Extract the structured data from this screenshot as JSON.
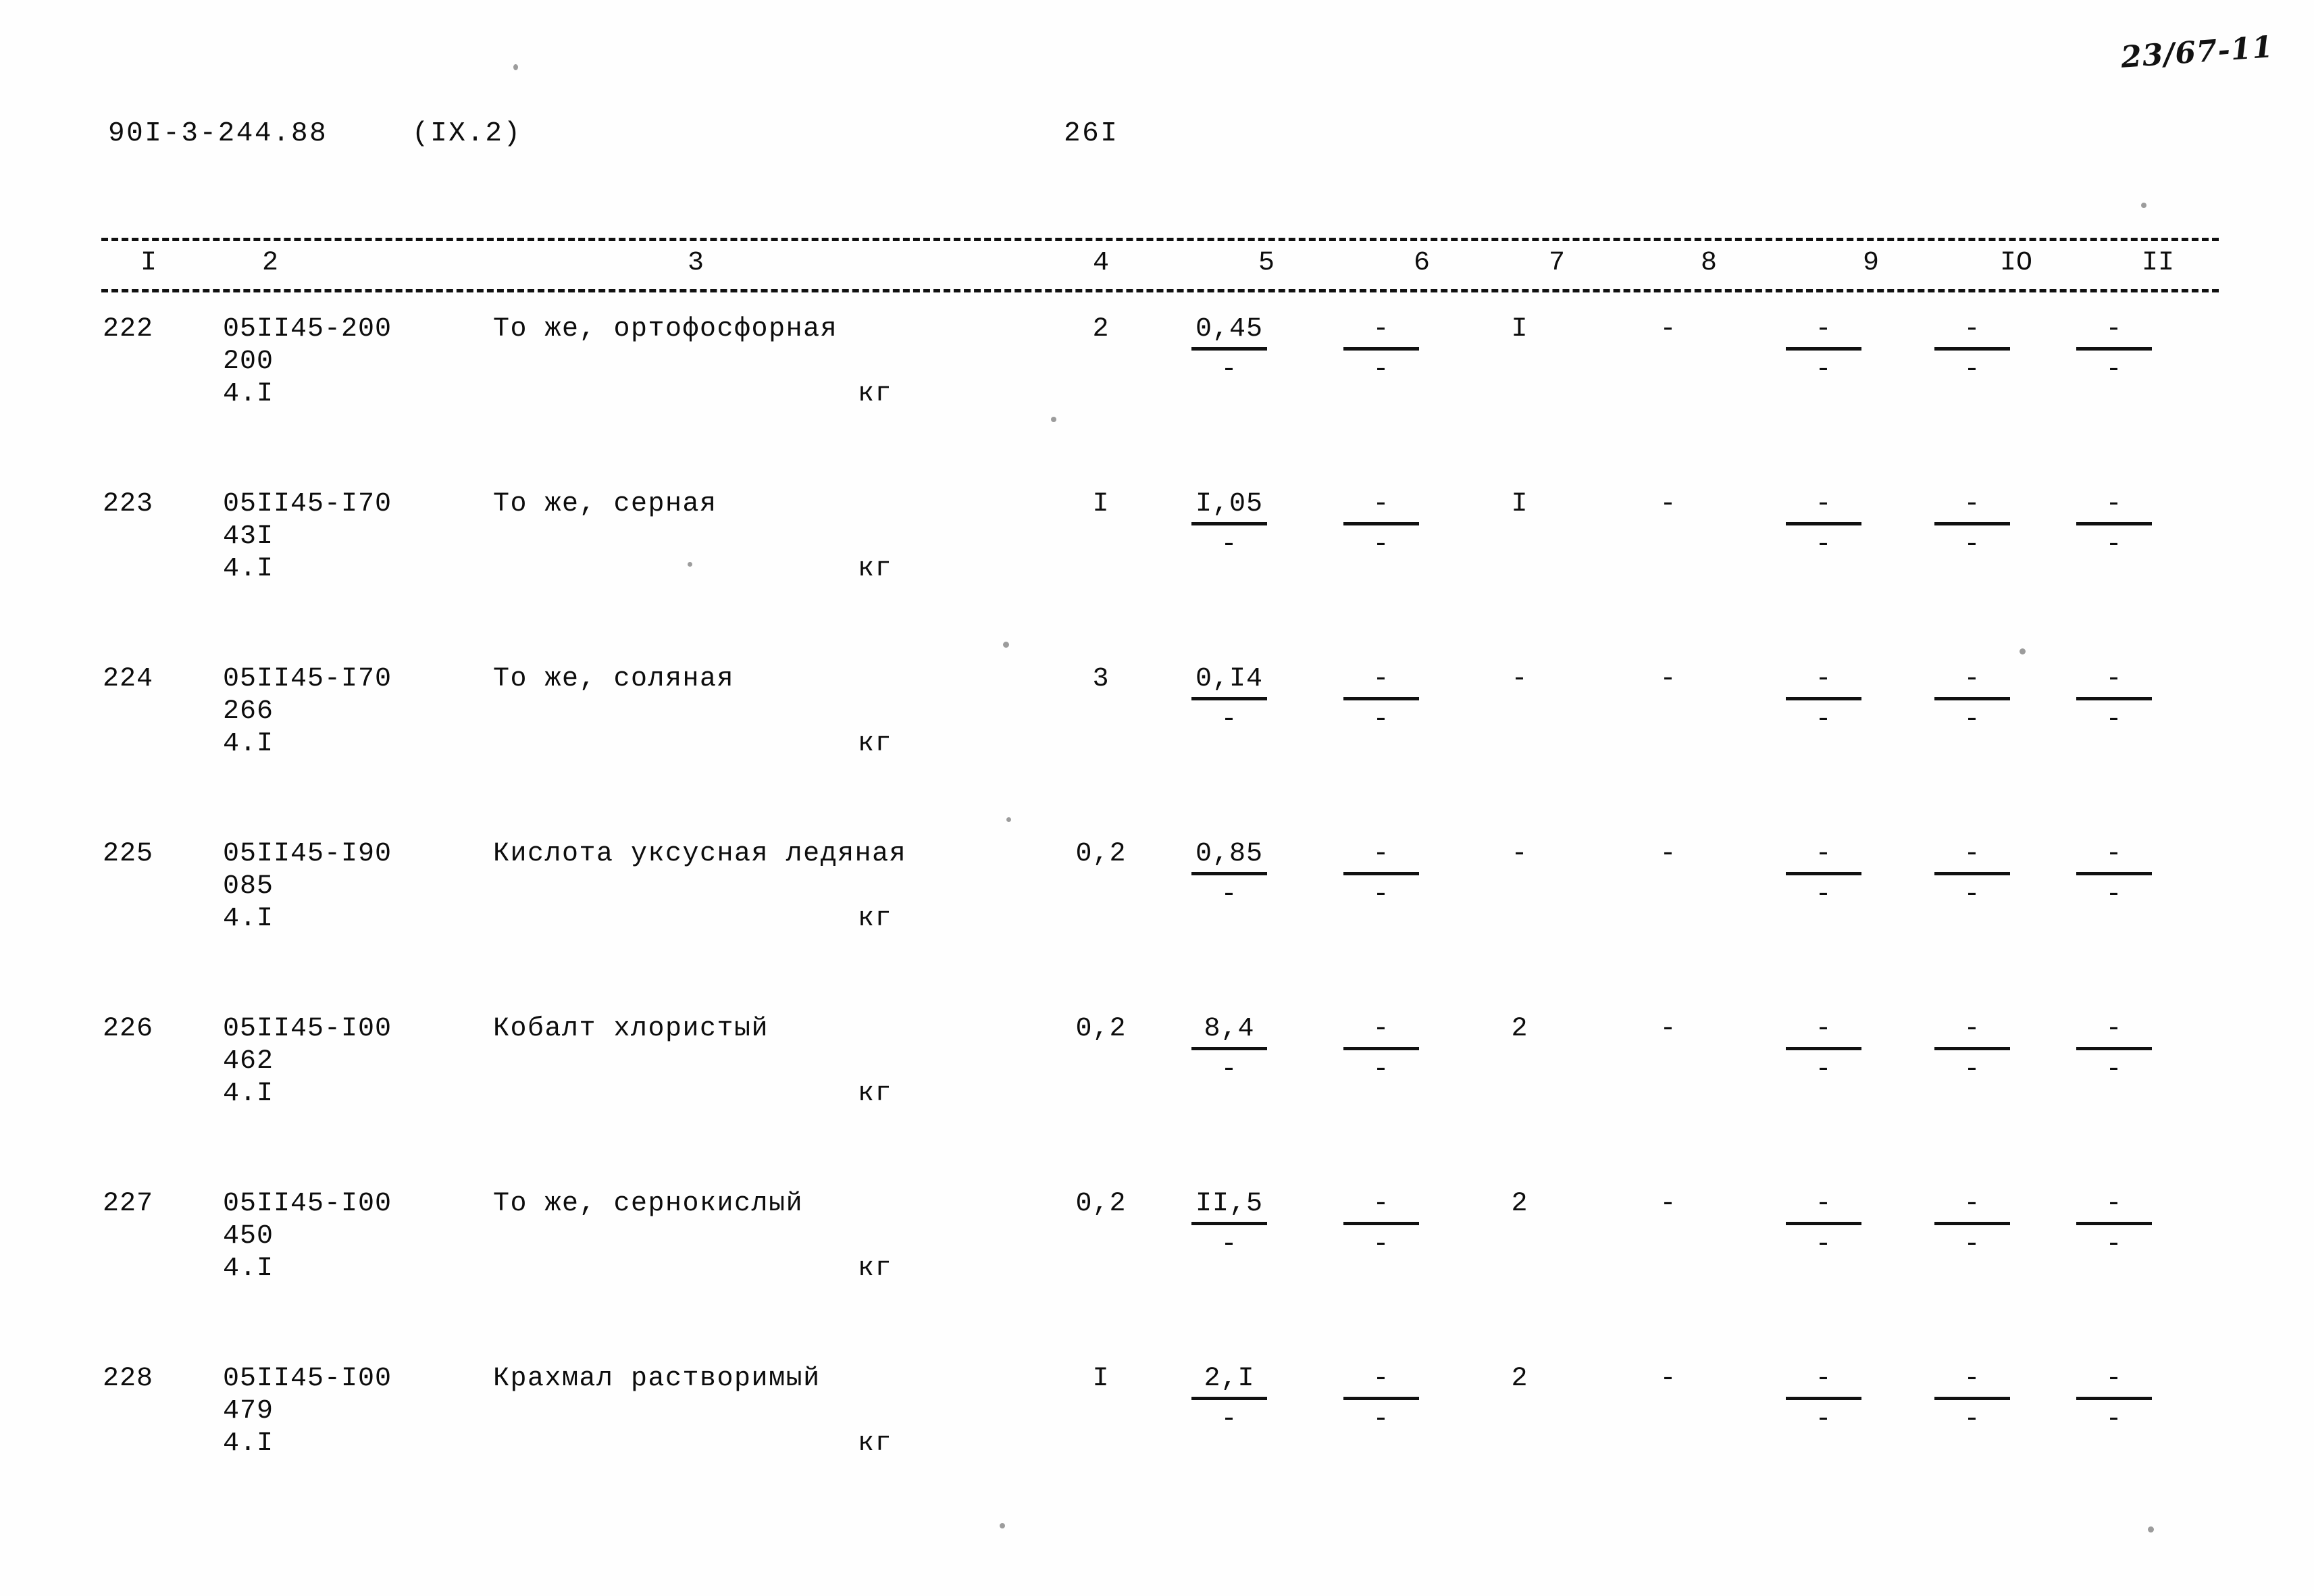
{
  "archive_mark": "23/67-11",
  "header": {
    "doc_code": "90I-3-244.88",
    "doc_section": "(IX.2)",
    "page_number": "26I"
  },
  "table": {
    "column_headers": [
      "I",
      "2",
      "3",
      "4",
      "5",
      "6",
      "7",
      "8",
      "9",
      "IO",
      "II"
    ],
    "rows": [
      {
        "num": "222",
        "code1": "05II45-200",
        "code2": "200",
        "code3": "4.I",
        "name": "То же, ортофосфорная",
        "unit": "кг",
        "qty": "2",
        "c5_num": "0,45",
        "c5_den": "-",
        "c6_num": "-",
        "c6_den": "-",
        "c7": "I",
        "c8": "-",
        "c9_num": "-",
        "c9_den": "-",
        "c10_num": "-",
        "c10_den": "-",
        "c11_num": "-",
        "c11_den": "-"
      },
      {
        "num": "223",
        "code1": "05II45-I70",
        "code2": "43I",
        "code3": "4.I",
        "name": "То же, серная",
        "unit": "кг",
        "qty": "I",
        "c5_num": "I,05",
        "c5_den": "-",
        "c6_num": "-",
        "c6_den": "-",
        "c7": "I",
        "c8": "-",
        "c9_num": "-",
        "c9_den": "-",
        "c10_num": "-",
        "c10_den": "-",
        "c11_num": "-",
        "c11_den": "-"
      },
      {
        "num": "224",
        "code1": "05II45-I70",
        "code2": "266",
        "code3": "4.I",
        "name": "То же, соляная",
        "unit": "кг",
        "qty": "3",
        "c5_num": "0,I4",
        "c5_den": "-",
        "c6_num": "-",
        "c6_den": "-",
        "c7": "-",
        "c8": "-",
        "c9_num": "-",
        "c9_den": "-",
        "c10_num": "-",
        "c10_den": "-",
        "c11_num": "-",
        "c11_den": "-"
      },
      {
        "num": "225",
        "code1": "05II45-I90",
        "code2": "085",
        "code3": "4.I",
        "name": "Кислота уксусная ледяная",
        "unit": "кг",
        "qty": "0,2",
        "c5_num": "0,85",
        "c5_den": "-",
        "c6_num": "-",
        "c6_den": "-",
        "c7": "-",
        "c8": "-",
        "c9_num": "-",
        "c9_den": "-",
        "c10_num": "-",
        "c10_den": "-",
        "c11_num": "-",
        "c11_den": "-"
      },
      {
        "num": "226",
        "code1": "05II45-I00",
        "code2": "462",
        "code3": "4.I",
        "name": "Кобалт хлористый",
        "unit": "кг",
        "qty": "0,2",
        "c5_num": "8,4",
        "c5_den": "-",
        "c6_num": "-",
        "c6_den": "-",
        "c7": "2",
        "c8": "-",
        "c9_num": "-",
        "c9_den": "-",
        "c10_num": "-",
        "c10_den": "-",
        "c11_num": "-",
        "c11_den": "-"
      },
      {
        "num": "227",
        "code1": "05II45-I00",
        "code2": "450",
        "code3": "4.I",
        "name": "То же, сернокислый",
        "unit": "кг",
        "qty": "0,2",
        "c5_num": "II,5",
        "c5_den": "-",
        "c6_num": "-",
        "c6_den": "-",
        "c7": "2",
        "c8": "-",
        "c9_num": "-",
        "c9_den": "-",
        "c10_num": "-",
        "c10_den": "-",
        "c11_num": "-",
        "c11_den": "-"
      },
      {
        "num": "228",
        "code1": "05II45-I00",
        "code2": "479",
        "code3": "4.I",
        "name": "Крахмал растворимый",
        "unit": "кг",
        "qty": "I",
        "c5_num": "2,I",
        "c5_den": "-",
        "c6_num": "-",
        "c6_den": "-",
        "c7": "2",
        "c8": "-",
        "c9_num": "-",
        "c9_den": "-",
        "c10_num": "-",
        "c10_den": "-",
        "c11_num": "-",
        "c11_den": "-"
      }
    ]
  }
}
